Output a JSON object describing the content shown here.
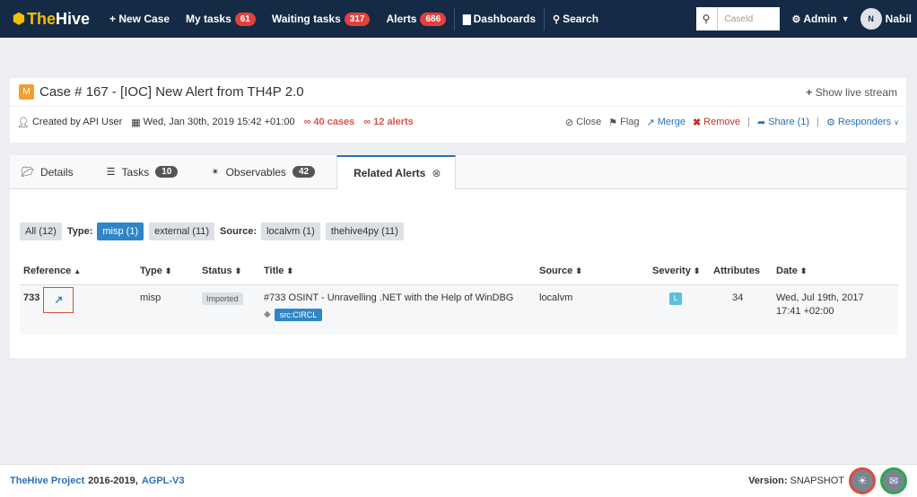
{
  "navbar": {
    "brand_prefix": "The",
    "brand_suffix": "Hive",
    "new_case": "+ New Case",
    "my_tasks": "My tasks",
    "my_tasks_count": "61",
    "waiting_tasks": "Waiting tasks",
    "waiting_tasks_count": "317",
    "alerts": "Alerts",
    "alerts_count": "686",
    "dashboards": "Dashboards",
    "search": "Search",
    "search_placeholder": "CaseId",
    "admin": "Admin",
    "avatar_initial": "N",
    "user": "Nabil"
  },
  "case": {
    "severity": "M",
    "title": "Case # 167 - [IOC] New Alert from TH4P 2.0",
    "live_stream": "Show live stream",
    "created_by": "Created by API User",
    "date": "Wed, Jan 30th, 2019 15:42 +01:00",
    "cases": "40 cases",
    "alerts": "12 alerts",
    "actions": {
      "close": "Close",
      "flag": "Flag",
      "merge": "Merge",
      "remove": "Remove",
      "share": "Share (1)",
      "responders": "Responders"
    }
  },
  "tabs": {
    "details": "Details",
    "tasks": "Tasks",
    "tasks_count": "10",
    "observables": "Observables",
    "observables_count": "42",
    "related_alerts": "Related Alerts"
  },
  "filters": {
    "all": "All (12)",
    "type_label": "Type:",
    "misp": "misp (1)",
    "external": "external (11)",
    "source_label": "Source:",
    "localvm": "localvm (1)",
    "thehive4py": "thehive4py (11)"
  },
  "table": {
    "headers": [
      "Reference",
      "Type",
      "Status",
      "Title",
      "Source",
      "Severity",
      "Attributes",
      "Date"
    ],
    "rows": [
      {
        "reference": "733",
        "type": "misp",
        "status": "Imported",
        "title": "#733 OSINT - Unravelling .NET with the Help of WinDBG",
        "tag": "src:CIRCL",
        "source": "localvm",
        "severity": "L",
        "attributes": "34",
        "date_line1": "Wed, Jul 19th, 2017",
        "date_line2": "17:41 +02:00"
      }
    ]
  },
  "footer": {
    "project": "TheHive Project",
    "years": "2016-2019,",
    "license": "AGPL-V3",
    "version_label": "Version:",
    "version": "SNAPSHOT"
  }
}
